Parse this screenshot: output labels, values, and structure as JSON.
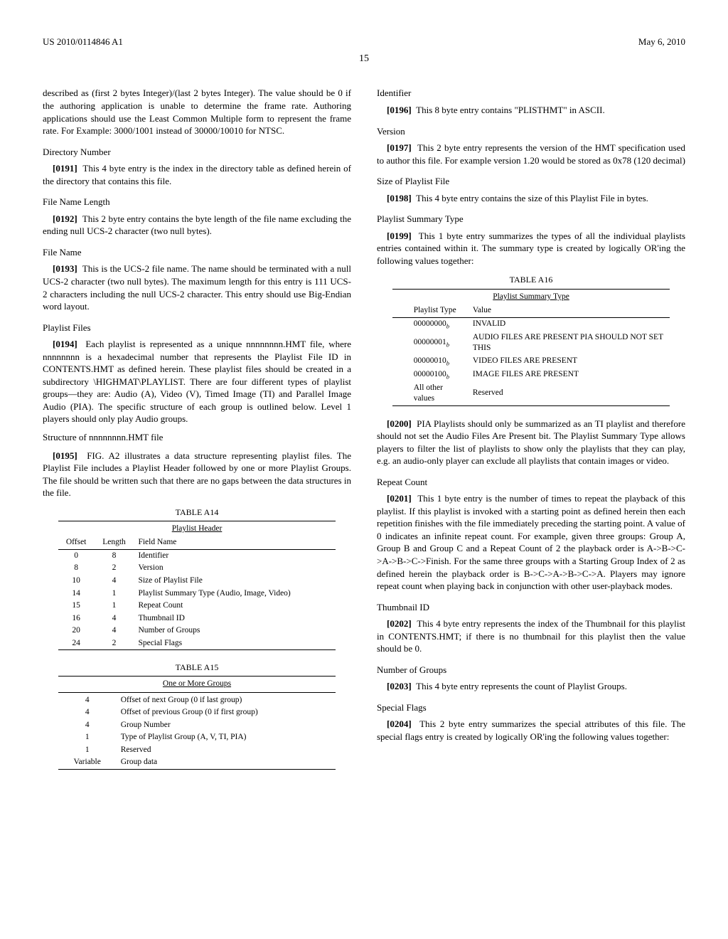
{
  "header": {
    "pub_number": "US 2010/0114846 A1",
    "date": "May 6, 2010",
    "page": "15"
  },
  "left": {
    "intro": "described as (first 2 bytes Integer)/(last 2 bytes Integer). The value should be 0 if the authoring application is unable to determine the frame rate. Authoring applications should use the Least Common Multiple form to represent the frame rate. For Example: 3000/1001 instead of 30000/10010 for NTSC.",
    "dir_num_title": "Directory Number",
    "p0191_num": "[0191]",
    "p0191": "This 4 byte entry is the index in the directory table as defined herein of the directory that contains this file.",
    "file_name_len_title": "File Name Length",
    "p0192_num": "[0192]",
    "p0192": "This 2 byte entry contains the byte length of the file name excluding the ending null UCS-2 character (two null bytes).",
    "file_name_title": "File Name",
    "p0193_num": "[0193]",
    "p0193": "This is the UCS-2 file name. The name should be terminated with a null UCS-2 character (two null bytes). The maximum length for this entry is 111 UCS-2 characters including the null UCS-2 character. This entry should use Big-Endian word layout.",
    "playlist_files_title": "Playlist Files",
    "p0194_num": "[0194]",
    "p0194": "Each playlist is represented as a unique nnnnnnnn.HMT file, where nnnnnnnn is a hexadecimal number that represents the Playlist File ID in CONTENTS.HMT as defined herein. These playlist files should be created in a subdirectory \\HIGHMAT\\PLAYLIST. There are four different types of playlist groups—they are: Audio (A), Video (V), Timed Image (TI) and Parallel Image Audio (PIA). The specific structure of each group is outlined below. Level 1 players should only play Audio groups.",
    "struct_line": "Structure of nnnnnnnn.HMT file",
    "p0195_num": "[0195]",
    "p0195": "FIG. A2 illustrates a data structure representing playlist files. The Playlist File includes a Playlist Header followed by one or more Playlist Groups. The file should be written such that there are no gaps between the data structures in the file.",
    "table_a14_label": "TABLE A14",
    "table_a14_caption": "Playlist Header",
    "table_a14_headers": {
      "c1": "Offset",
      "c2": "Length",
      "c3": "Field Name"
    },
    "table_a14_rows": [
      {
        "c1": "0",
        "c2": "8",
        "c3": "Identifier"
      },
      {
        "c1": "8",
        "c2": "2",
        "c3": "Version"
      },
      {
        "c1": "10",
        "c2": "4",
        "c3": "Size of Playlist File"
      },
      {
        "c1": "14",
        "c2": "1",
        "c3": "Playlist Summary Type (Audio, Image, Video)"
      },
      {
        "c1": "15",
        "c2": "1",
        "c3": "Repeat Count"
      },
      {
        "c1": "16",
        "c2": "4",
        "c3": "Thumbnail ID"
      },
      {
        "c1": "20",
        "c2": "4",
        "c3": "Number of Groups"
      },
      {
        "c1": "24",
        "c2": "2",
        "c3": "Special Flags"
      }
    ],
    "table_a15_label": "TABLE A15",
    "table_a15_caption": "One or More Groups",
    "table_a15_rows": [
      {
        "c1": "4",
        "c2": "Offset of next Group (0 if last group)"
      },
      {
        "c1": "4",
        "c2": "Offset of previous Group (0 if first group)"
      },
      {
        "c1": "4",
        "c2": "Group Number"
      },
      {
        "c1": "1",
        "c2": "Type of Playlist Group (A, V, TI, PIA)"
      },
      {
        "c1": "1",
        "c2": "Reserved"
      },
      {
        "c1": "Variable",
        "c2": "Group data"
      }
    ]
  },
  "right": {
    "identifier_title": "Identifier",
    "p0196_num": "[0196]",
    "p0196": "This 8 byte entry contains \"PLISTHMT\" in ASCII.",
    "version_title": "Version",
    "p0197_num": "[0197]",
    "p0197": "This 2 byte entry represents the version of the HMT specification used to author this file. For example version 1.20 would be stored as 0x78 (120 decimal)",
    "size_title": "Size of Playlist File",
    "p0198_num": "[0198]",
    "p0198": "This 4 byte entry contains the size of this Playlist File in bytes.",
    "summary_type_title": "Playlist Summary Type",
    "p0199_num": "[0199]",
    "p0199": "This 1 byte entry summarizes the types of all the individual playlists entries contained within it. The summary type is created by logically OR'ing the following values together:",
    "table_a16_label": "TABLE A16",
    "table_a16_caption": "Playlist Summary Type",
    "table_a16_headers": {
      "c1": "Playlist Type",
      "c2": "Value"
    },
    "table_a16_rows": [
      {
        "c1": "00000000",
        "sub": "b",
        "c2": "INVALID"
      },
      {
        "c1": "00000001",
        "sub": "b",
        "c2": "AUDIO FILES ARE PRESENT PIA SHOULD NOT SET THIS"
      },
      {
        "c1": "00000010",
        "sub": "b",
        "c2": "VIDEO FILES ARE PRESENT"
      },
      {
        "c1": "00000100",
        "sub": "b",
        "c2": "IMAGE FILES ARE PRESENT"
      },
      {
        "c1": "All other values",
        "sub": "",
        "c2": "Reserved"
      }
    ],
    "p0200_num": "[0200]",
    "p0200": "PIA Playlists should only be summarized as an TI playlist and therefore should not set the Audio Files Are Present bit. The Playlist Summary Type allows players to filter the list of playlists to show only the playlists that they can play, e.g. an audio-only player can exclude all playlists that contain images or video.",
    "repeat_title": "Repeat Count",
    "p0201_num": "[0201]",
    "p0201": "This 1 byte entry is the number of times to repeat the playback of this playlist. If this playlist is invoked with a starting point as defined herein then each repetition finishes with the file immediately preceding the starting point. A value of 0 indicates an infinite repeat count. For example, given three groups: Group A, Group B and Group C and a Repeat Count of 2 the playback order is A->B->C->A->B->C->Finish. For the same three groups with a Starting Group Index of 2 as defined herein the playback order is B->C->A->B->C->A. Players may ignore repeat count when playing back in conjunction with other user-playback modes.",
    "thumb_title": "Thumbnail ID",
    "p0202_num": "[0202]",
    "p0202": "This 4 byte entry represents the index of the Thumbnail for this playlist in CONTENTS.HMT; if there is no thumbnail for this playlist then the value should be 0.",
    "num_groups_title": "Number of Groups",
    "p0203_num": "[0203]",
    "p0203": "This 4 byte entry represents the count of Playlist Groups.",
    "special_flags_title": "Special Flags",
    "p0204_num": "[0204]",
    "p0204": "This 2 byte entry summarizes the special attributes of this file. The special flags entry is created by logically OR'ing the following values together:"
  }
}
